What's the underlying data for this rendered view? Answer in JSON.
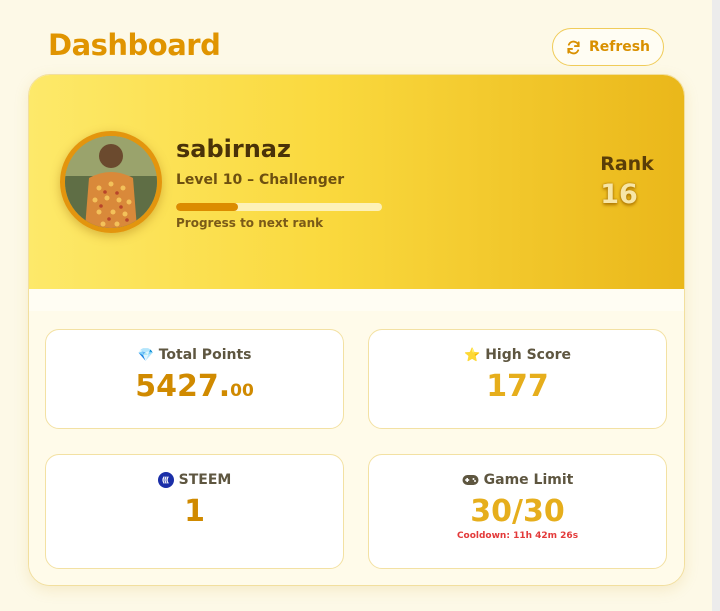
{
  "header": {
    "title": "Dashboard",
    "refresh_label": "Refresh",
    "refresh_icon": "refresh-icon"
  },
  "profile": {
    "username": "sabirnaz",
    "level_text": "Level 10 – Challenger",
    "progress_fraction": 0.3,
    "progress_label": "Progress to next rank",
    "rank_label": "Rank",
    "rank_value": "16",
    "avatar_icon": "user-avatar"
  },
  "stats": {
    "total_points": {
      "icon": "💎",
      "label": "Total Points",
      "value_int": "5427.",
      "value_dec": "00"
    },
    "high_score": {
      "icon": "⭐",
      "label": "High Score",
      "value": "177"
    },
    "steem": {
      "icon": "steem-icon",
      "label": "STEEM",
      "value": "1"
    },
    "game_limit": {
      "icon": "gamepad-icon",
      "label": "Game Limit",
      "value": "30/30",
      "cooldown": "Cooldown: 11h 42m 26s"
    }
  },
  "colors": {
    "accent": "#e09400",
    "background": "#fdf9e7",
    "hero_start": "#fde96a",
    "hero_end": "#eab71a",
    "progress_fill": "#dc8c00",
    "cooldown": "#e33a3a"
  }
}
